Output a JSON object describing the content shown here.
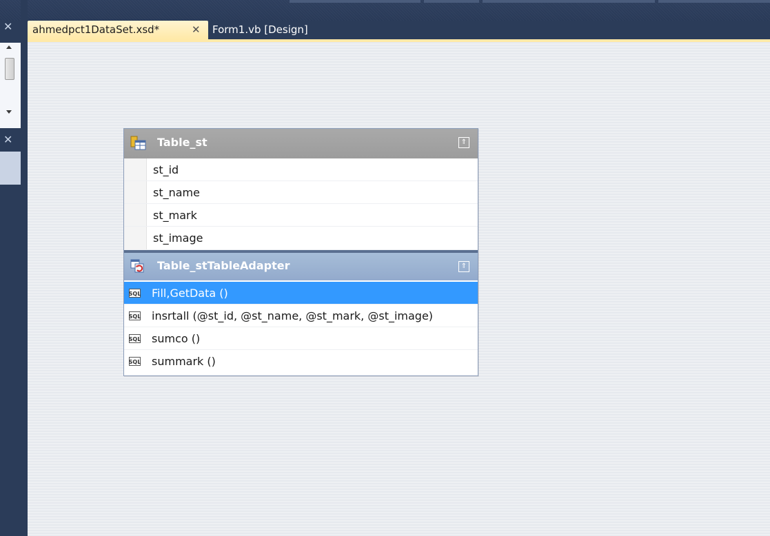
{
  "tabs": [
    {
      "label": "ahmedpct1DataSet.xsd*",
      "active": true
    },
    {
      "label": "Form1.vb [Design]",
      "active": false
    }
  ],
  "icons": {
    "close": "✕",
    "collapse": "⇑"
  },
  "table": {
    "name": "Table_st",
    "columns": [
      "st_id",
      "st_name",
      "st_mark",
      "st_image"
    ]
  },
  "adapter": {
    "name": "Table_stTableAdapter",
    "queries": [
      {
        "label": "Fill,GetData ()",
        "selected": true
      },
      {
        "label": "insrtall (@st_id, @st_name, @st_mark, @st_image)",
        "selected": false
      },
      {
        "label": "sumco ()",
        "selected": false
      },
      {
        "label": "summark ()",
        "selected": false
      }
    ]
  },
  "colors": {
    "selection": "#3399ff",
    "active_tab": "#ffe9a8",
    "chrome": "#2b3c59"
  }
}
